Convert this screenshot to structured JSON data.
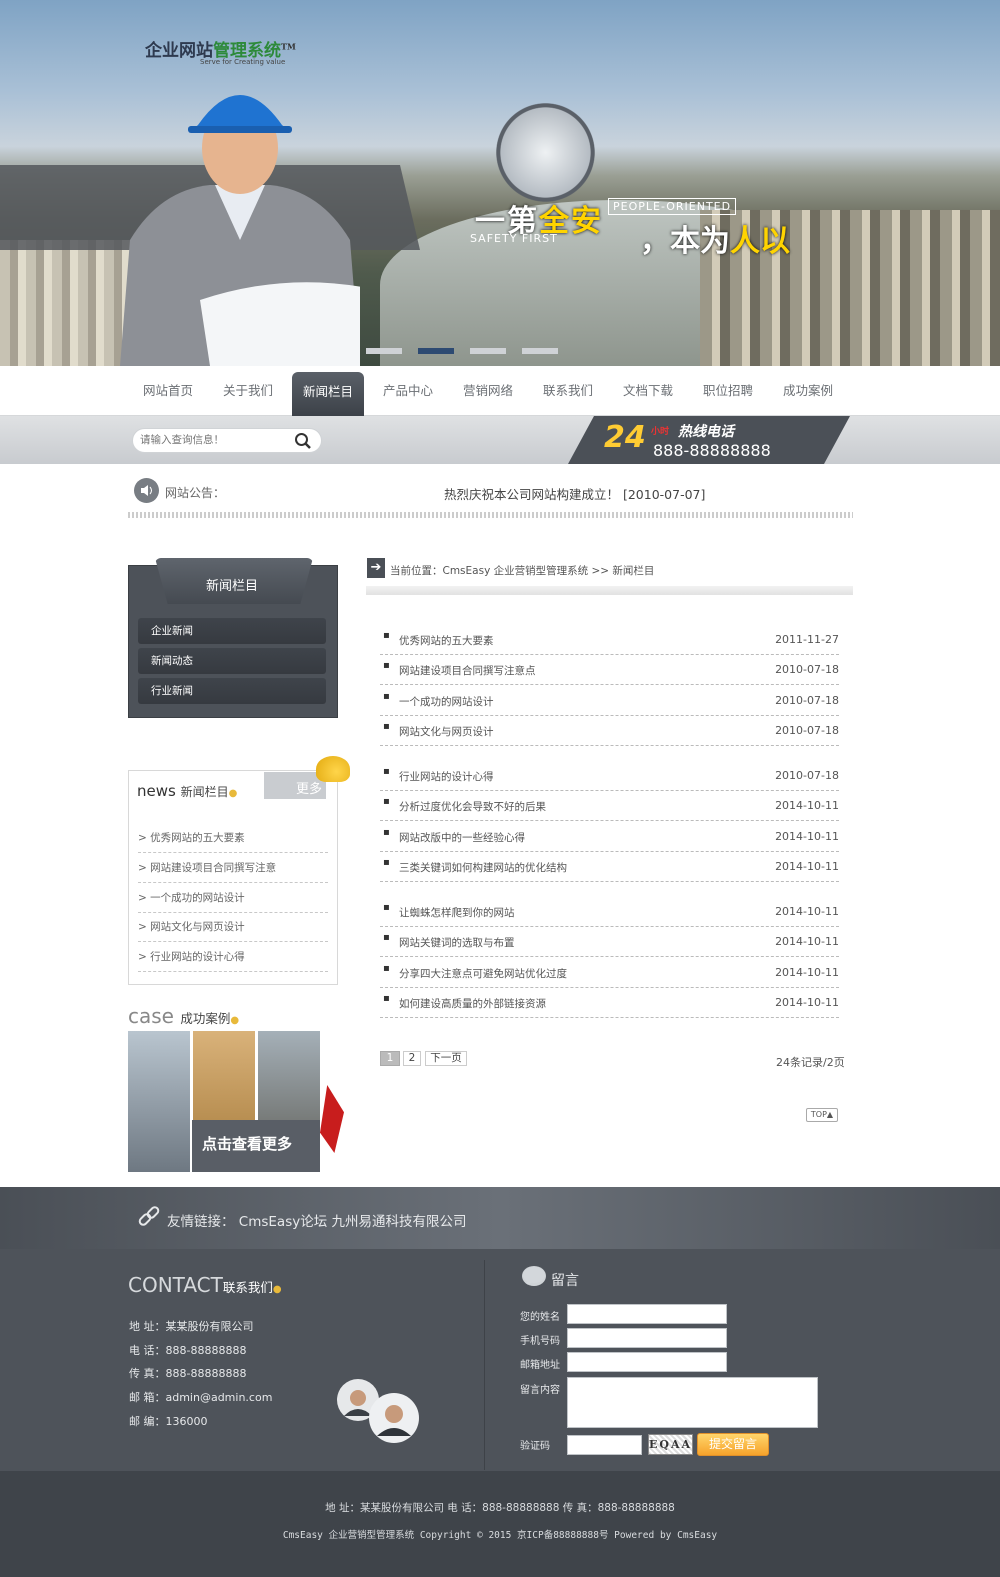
{
  "brand": {
    "logo_part1": "企业网站",
    "logo_part2": "管理系统",
    "logo_tm": "TM",
    "logo_sub": "Serve for Creating value"
  },
  "banner": {
    "slogan_white": "一第",
    "slogan_yellow": "全安",
    "slogan_en1": "PEOPLE-ORIENTED",
    "slogan2_white": "，本为",
    "slogan2_yellow": "人以",
    "slogan_en2": "SAFETY FIRST",
    "active_slide": 2
  },
  "nav": {
    "items": [
      "网站首页",
      "关于我们",
      "新闻栏目",
      "产品中心",
      "营销网络",
      "联系我们",
      "文档下载",
      "职位招聘",
      "成功案例"
    ],
    "active": "新闻栏目"
  },
  "search": {
    "placeholder": "请输入查询信息！"
  },
  "hotline": {
    "num24": "24",
    "xs": "小时",
    "title": "热线电话",
    "phone": "888-88888888"
  },
  "notice": {
    "label": "网站公告：",
    "text": "热烈庆祝本公司网站构建成立！ [2010-07-07]"
  },
  "sidebar": {
    "title": "新闻栏目",
    "items": [
      "企业新闻",
      "新闻动态",
      "行业新闻"
    ]
  },
  "news_box": {
    "title_en": "news",
    "title_cn": "新闻栏目",
    "more": "更多",
    "items": [
      "> 优秀网站的五大要素",
      "> 网站建设项目合同撰写注意",
      "> 一个成功的网站设计",
      "> 网站文化与网页设计",
      "> 行业网站的设计心得"
    ]
  },
  "case_box": {
    "title_en": "case",
    "title_cn": "成功案例",
    "button": "点击查看更多"
  },
  "breadcrumb": {
    "text": "当前位置：CmsEasy 企业营销型管理系统 >> 新闻栏目"
  },
  "articles": [
    {
      "title": "优秀网站的五大要素",
      "date": "2011-11-27"
    },
    {
      "title": "网站建设项目合同撰写注意点",
      "date": "2010-07-18"
    },
    {
      "title": "一个成功的网站设计",
      "date": "2010-07-18"
    },
    {
      "title": "网站文化与网页设计",
      "date": "2010-07-18"
    },
    {
      "title": "行业网站的设计心得",
      "date": "2010-07-18"
    },
    {
      "title": "分析过度优化会导致不好的后果",
      "date": "2014-10-11"
    },
    {
      "title": "网站改版中的一些经验心得",
      "date": "2014-10-11"
    },
    {
      "title": "三类关键词如何构建网站的优化结构",
      "date": "2014-10-11"
    },
    {
      "title": "让蜘蛛怎样爬到你的网站",
      "date": "2014-10-11"
    },
    {
      "title": "网站关键词的选取与布置",
      "date": "2014-10-11"
    },
    {
      "title": "分享四大注意点可避免网站优化过度",
      "date": "2014-10-11"
    },
    {
      "title": "如何建设高质量的外部链接资源",
      "date": "2014-10-11"
    }
  ],
  "pagination": {
    "p1": "1",
    "p2": "2",
    "next": "下一页",
    "total": "24条记录/2页",
    "top": "TOP▲"
  },
  "links": {
    "text": "友情链接：  CmsEasy论坛    九州易通科技有限公司"
  },
  "contact": {
    "title_en": "CONTACT",
    "title_cn": "联系我们",
    "lines": [
      "地 址：某某股份有限公司",
      "电 话：888-88888888",
      "传 真：888-88888888",
      "邮 箱：admin@admin.com",
      "邮 编：136000"
    ]
  },
  "message": {
    "title": "留言",
    "name_label": "您的姓名",
    "phone_label": "手机号码",
    "email_label": "邮箱地址",
    "content_label": "留言内容",
    "captcha_label": "验证码",
    "captcha_text": "EQAA",
    "submit": "提交留言"
  },
  "footer": {
    "line1": "地 址：某某股份有限公司      电 话：888-88888888      传  真：888-88888888",
    "line2": "CmsEasy 企业营销型管理系统 Copyright © 2015     京ICP备88888888号     Powered by CmsEasy"
  },
  "colors": {
    "nav_active": "#454a51",
    "footer_bg": "#4e535a",
    "submit": "#f6a32b",
    "accent_yellow": "#ffd400"
  }
}
